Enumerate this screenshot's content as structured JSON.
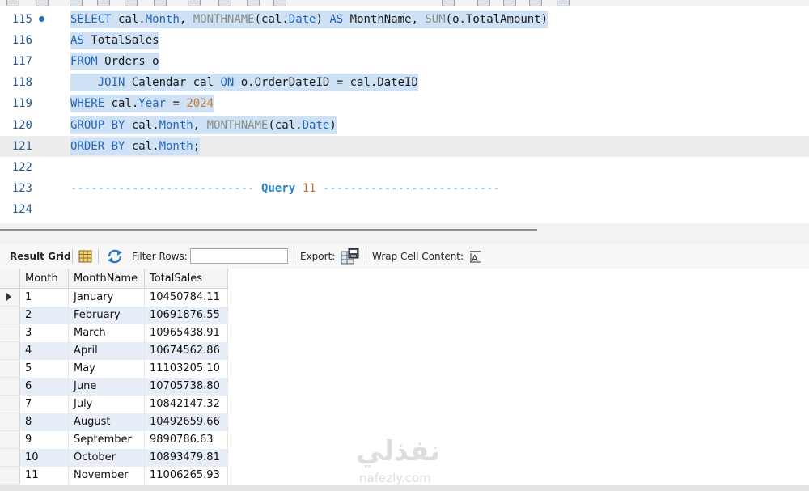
{
  "editor": {
    "lines": [
      {
        "num": "115",
        "has_bullet": true,
        "selected": true,
        "current": false,
        "segments": [
          {
            "t": "SELECT ",
            "c": "k"
          },
          {
            "t": "cal.",
            "c": ""
          },
          {
            "t": "Month",
            "c": "k"
          },
          {
            "t": ", ",
            "c": ""
          },
          {
            "t": "MONTHNAME",
            "c": "f"
          },
          {
            "t": "(cal.",
            "c": ""
          },
          {
            "t": "Date",
            "c": "k"
          },
          {
            "t": ") ",
            "c": ""
          },
          {
            "t": "AS ",
            "c": "k"
          },
          {
            "t": "MonthName, ",
            "c": ""
          },
          {
            "t": "SUM",
            "c": "f"
          },
          {
            "t": "(o.TotalAmount)",
            "c": ""
          }
        ]
      },
      {
        "num": "116",
        "has_bullet": false,
        "selected": true,
        "current": false,
        "segments": [
          {
            "t": "AS ",
            "c": "k"
          },
          {
            "t": "TotalSales",
            "c": ""
          }
        ]
      },
      {
        "num": "117",
        "has_bullet": false,
        "selected": true,
        "current": false,
        "segments": [
          {
            "t": "FROM ",
            "c": "k"
          },
          {
            "t": "Orders o",
            "c": ""
          }
        ]
      },
      {
        "num": "118",
        "has_bullet": false,
        "selected": true,
        "current": false,
        "segments": [
          {
            "t": "    JOIN ",
            "c": "k"
          },
          {
            "t": "Calendar cal ",
            "c": ""
          },
          {
            "t": "ON ",
            "c": "k"
          },
          {
            "t": "o.OrderDateID = cal.DateID",
            "c": ""
          }
        ]
      },
      {
        "num": "119",
        "has_bullet": false,
        "selected": true,
        "current": false,
        "segments": [
          {
            "t": "WHERE ",
            "c": "k"
          },
          {
            "t": "cal.",
            "c": ""
          },
          {
            "t": "Year",
            "c": "k"
          },
          {
            "t": " = ",
            "c": ""
          },
          {
            "t": "2024",
            "c": "n"
          }
        ]
      },
      {
        "num": "120",
        "has_bullet": false,
        "selected": true,
        "current": false,
        "segments": [
          {
            "t": "GROUP BY ",
            "c": "k"
          },
          {
            "t": "cal.",
            "c": ""
          },
          {
            "t": "Month",
            "c": "k"
          },
          {
            "t": ", ",
            "c": ""
          },
          {
            "t": "MONTHNAME",
            "c": "f"
          },
          {
            "t": "(cal.",
            "c": ""
          },
          {
            "t": "Date",
            "c": "k"
          },
          {
            "t": ")",
            "c": ""
          }
        ]
      },
      {
        "num": "121",
        "has_bullet": false,
        "selected": true,
        "current": true,
        "segments": [
          {
            "t": "ORDER BY ",
            "c": "k"
          },
          {
            "t": "cal.",
            "c": ""
          },
          {
            "t": "Month",
            "c": "k"
          },
          {
            "t": ";",
            "c": ""
          }
        ]
      },
      {
        "num": "122",
        "has_bullet": false,
        "selected": false,
        "current": false,
        "segments": []
      },
      {
        "num": "123",
        "has_bullet": false,
        "selected": false,
        "current": false,
        "segments": [
          {
            "t": "--------------------------- ",
            "c": "dash"
          },
          {
            "t": "Query",
            "c": "qlabel"
          },
          {
            "t": " ",
            "c": ""
          },
          {
            "t": "11",
            "c": "n"
          },
          {
            "t": " --------------------------",
            "c": "dash"
          }
        ]
      },
      {
        "num": "124",
        "has_bullet": false,
        "selected": false,
        "current": false,
        "segments": []
      }
    ]
  },
  "result_toolbar": {
    "result_grid_label": "Result Grid",
    "filter_rows_label": "Filter Rows:",
    "filter_value": "",
    "export_label": "Export:",
    "wrap_label": "Wrap Cell Content:"
  },
  "grid": {
    "columns": [
      "Month",
      "MonthName",
      "TotalSales"
    ],
    "rows": [
      [
        "1",
        "January",
        "10450784.11"
      ],
      [
        "2",
        "February",
        "10691876.55"
      ],
      [
        "3",
        "March",
        "10965438.91"
      ],
      [
        "4",
        "April",
        "10674562.86"
      ],
      [
        "5",
        "May",
        "11103205.10"
      ],
      [
        "6",
        "June",
        "10705738.80"
      ],
      [
        "7",
        "July",
        "10842147.32"
      ],
      [
        "8",
        "August",
        "10492659.66"
      ],
      [
        "9",
        "September",
        "9890786.63"
      ],
      [
        "10",
        "October",
        "10893479.81"
      ],
      [
        "11",
        "November",
        "11006265.93"
      ]
    ]
  },
  "watermark": {
    "arabic": "نفذلي",
    "latin": "nafezly.com"
  },
  "colors": {
    "keyword": "#2465b8",
    "function": "#8a8a8a",
    "number": "#c07a2c",
    "selection": "#cfe1f5",
    "row_alt": "#e8eef8"
  },
  "icons": [
    "grid-icon",
    "refresh-icon",
    "export-icon",
    "wrap-icon",
    "row-pointer-icon"
  ]
}
